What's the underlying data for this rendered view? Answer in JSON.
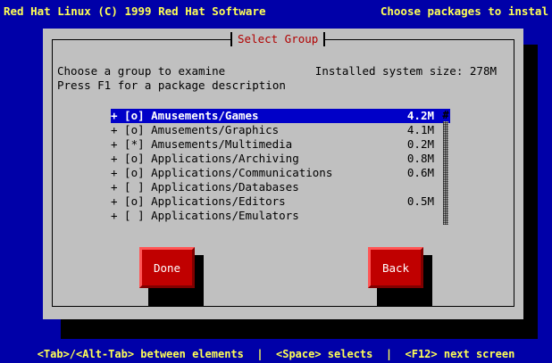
{
  "header": {
    "left_text": "Red Hat Linux (C) 1999 Red Hat Software",
    "right_text": "Choose packages to instal"
  },
  "dialog": {
    "title": "Select Group",
    "intro_line1": "Choose a group to examine",
    "intro_line2": "Press F1 for a package description",
    "installed_size": "Installed system size: 278M"
  },
  "groups": [
    {
      "text": "+ [o] Amusements/Games",
      "size": "4.2M",
      "selected": true
    },
    {
      "text": "+ [o] Amusements/Graphics",
      "size": "4.1M",
      "selected": false
    },
    {
      "text": "+ [*] Amusements/Multimedia",
      "size": "0.2M",
      "selected": false
    },
    {
      "text": "+ [o] Applications/Archiving",
      "size": "0.8M",
      "selected": false
    },
    {
      "text": "+ [o] Applications/Communications",
      "size": "0.6M",
      "selected": false
    },
    {
      "text": "+ [ ] Applications/Databases",
      "size": "",
      "selected": false
    },
    {
      "text": "+ [o] Applications/Editors",
      "size": "0.5M",
      "selected": false
    },
    {
      "text": "+ [ ] Applications/Emulators",
      "size": "",
      "selected": false
    }
  ],
  "scrollbar": {
    "thumb": "#"
  },
  "buttons": {
    "done": "Done",
    "back": "Back"
  },
  "footer": {
    "help_text": "<Tab>/<Alt-Tab> between elements  |  <Space> selects  |  <F12> next screen"
  }
}
